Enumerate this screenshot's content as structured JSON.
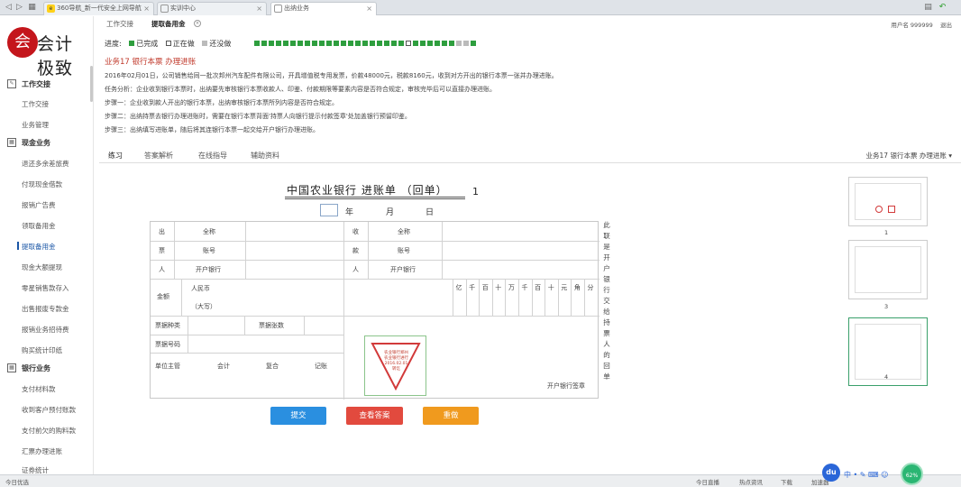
{
  "browser": {
    "tabs": [
      {
        "icon": "e",
        "label": "360导航_新一代安全上网导航"
      },
      {
        "icon": "",
        "label": "实训中心"
      },
      {
        "icon": "",
        "label": "出纳业务"
      }
    ]
  },
  "logo": {
    "text": "会计极致",
    "mark": "会"
  },
  "sidebar": {
    "groups": [
      {
        "label": "工作交接",
        "icon": "edit",
        "items": [
          "工作交接",
          "业务管理"
        ]
      },
      {
        "label": "现金业务",
        "icon": "grid",
        "items": [
          "退还多余差旅费",
          "付现现金借款",
          "报销广告费",
          "领取备用金",
          "提取备用金",
          "现金大额提现",
          "零星销售款存入",
          "出售报废专款金",
          "报销业务招待费",
          "购买统计印纸"
        ]
      },
      {
        "label": "银行业务",
        "icon": "grid",
        "items": [
          "支付材料款",
          "收到客户预付账款",
          "支付前欠的购料款",
          "汇票办理进账",
          "证券统计"
        ]
      }
    ],
    "active_item": "提取备用金"
  },
  "top_tabs": {
    "items": [
      "工作交接",
      "提取备用金"
    ],
    "user": "用户名 999999",
    "logout": "退出"
  },
  "progress": {
    "label": "进度:",
    "legend": [
      {
        "label": "已完成",
        "color": "#2e9e3e"
      },
      {
        "label": "正在做",
        "color": "#ffffff"
      },
      {
        "label": "还没做",
        "color": "#bbbbbb"
      }
    ],
    "steps": [
      "done",
      "done",
      "done",
      "done",
      "done",
      "done",
      "done",
      "done",
      "done",
      "done",
      "done",
      "done",
      "done",
      "done",
      "done",
      "done",
      "done",
      "done",
      "done",
      "done",
      "done",
      "current",
      "done",
      "done",
      "done",
      "done",
      "done",
      "done",
      "todo",
      "todo",
      "done"
    ]
  },
  "business": {
    "title": "业务17 银行本票 办理进账",
    "lines": [
      "2016年02月01日，公司销售给同一批次邦州汽车配件有限公司，开具增值税专用发票，价款48000元，税款8160元，收到对方开出的银行本票一张并办理进账。",
      "任务分析：企业收到银行本票时，出纳要先审核银行本票收款人、印鉴、付款期限等要素内容是否符合规定，审核完毕后可以直接办理进账。",
      "步骤一：企业收到款人开出的银行本票，出纳审核银行本票所列内容是否符合规定。",
      "步骤二：出纳持票去银行办理进账时，需要在银行本票背面'持票人向银行提示付款签章'处加盖银行预留印鉴。",
      "步骤三：出纳填写进账单，随后将其连银行本票一起交给开户银行办理进账。"
    ]
  },
  "content_tabs": {
    "items": [
      "练习",
      "答案解析",
      "在线指导",
      "辅助资料"
    ],
    "business_select": "业务17 银行本票 办理进账"
  },
  "document": {
    "title": "中国农业银行    进账单    （回单）",
    "copy_number": "1",
    "date_labels": [
      "年",
      "月",
      "日"
    ],
    "payer_side": [
      "出",
      "票",
      "人"
    ],
    "payee_side": [
      "收",
      "款",
      "人"
    ],
    "fields_left": [
      "全称",
      "账号",
      "开户银行"
    ],
    "fields_right": [
      "全称",
      "账号",
      "开户银行"
    ],
    "amount_label": "金额",
    "currency": "人民币",
    "uppercase": "（大写）",
    "digits": [
      "亿",
      "千",
      "百",
      "十",
      "万",
      "千",
      "百",
      "十",
      "元",
      "角",
      "分"
    ],
    "bill_type": "票据种类",
    "bill_count": "票据张数",
    "bill_number": "票据号码",
    "signers": [
      "单位主管",
      "会计",
      "复合",
      "记账"
    ],
    "bank_stamp_label": "开户银行签章",
    "stamp": {
      "lines": [
        "农业银行郑州",
        "农业银行进行",
        "2016.02.01",
        "转讫"
      ]
    },
    "side_note": [
      "此",
      "联",
      "是",
      "开",
      "户",
      "银",
      "行",
      "交",
      "给",
      "持",
      "票",
      "人",
      "的",
      "回",
      "单"
    ]
  },
  "buttons": {
    "submit": "提交",
    "view_answer": "查看答案",
    "redo": "重做"
  },
  "thumbnails": [
    "1",
    "2",
    "3",
    "4"
  ],
  "status_bar": {
    "left": "今日优选",
    "items": [
      "今日直播",
      "热点资讯",
      "下载",
      "加速器"
    ]
  },
  "tray": {
    "du": "du",
    "cpu": "62%"
  }
}
